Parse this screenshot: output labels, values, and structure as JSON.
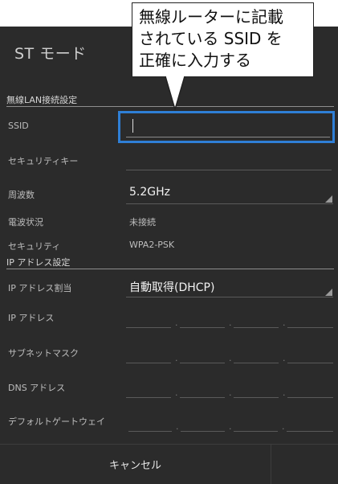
{
  "title": "ST モード",
  "callout": {
    "lines": [
      "無線ルーターに記載",
      "されている SSID を",
      "正確に入力する"
    ]
  },
  "wlan_section": {
    "heading": "無線LAN接続設定",
    "ssid_label": "SSID",
    "ssid_value": "",
    "security_key_label": "セキュリティキー",
    "security_key_value": "",
    "frequency_label": "周波数",
    "frequency_value": "5.2GHz",
    "signal_label": "電波状況",
    "signal_value": "未接続",
    "security_label": "セキュリティ",
    "security_value": "WPA2-PSK"
  },
  "ip_section": {
    "heading": "IP アドレス設定",
    "assign_label": "IP アドレス割当",
    "assign_value": "自動取得(DHCP)",
    "ip_label": "IP アドレス",
    "subnet_label": "サブネットマスク",
    "dns_label": "DNS アドレス",
    "gateway_label": "デフォルトゲートウェイ",
    "separator": "."
  },
  "footer": {
    "cancel_label": "キャンセル"
  },
  "colors": {
    "dialog_bg": "#2b2b2b",
    "focus_border": "#2f7fd6"
  },
  "icons": [
    "dropdown-triangle-icon"
  ]
}
